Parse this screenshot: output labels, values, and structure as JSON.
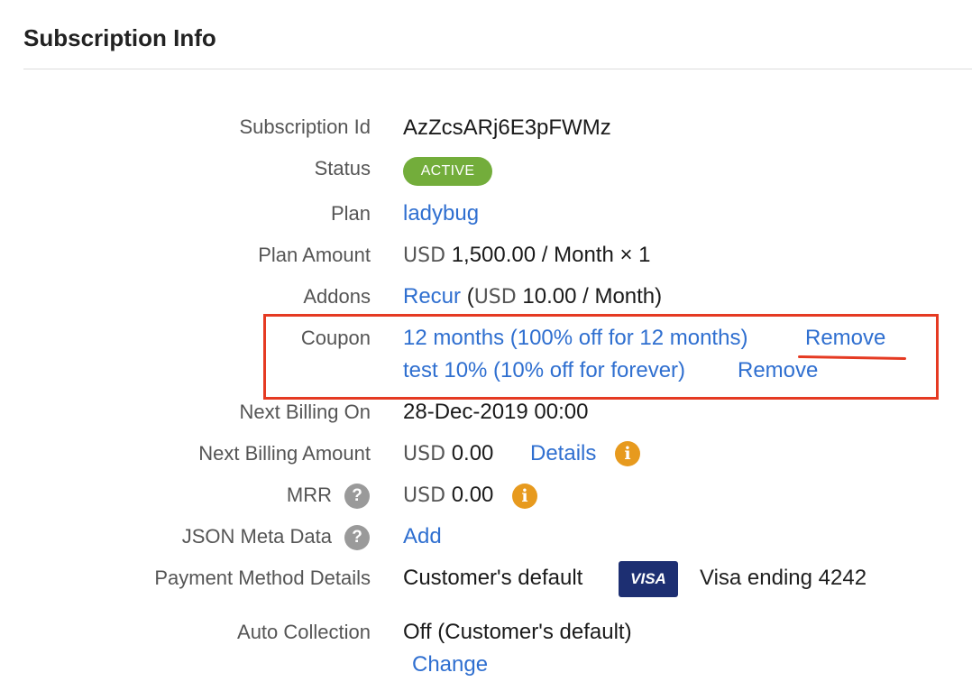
{
  "title": "Subscription Info",
  "fields": {
    "subscription_id": {
      "label": "Subscription Id",
      "value": "AzZcsARj6E3pFWMz"
    },
    "status": {
      "label": "Status",
      "value": "ACTIVE"
    },
    "plan": {
      "label": "Plan",
      "value": "ladybug"
    },
    "plan_amount": {
      "label": "Plan Amount",
      "currency": "USD",
      "value": "1,500.00 / Month × 1"
    },
    "addons": {
      "label": "Addons",
      "name": "Recur",
      "open": "(",
      "currency": "USD",
      "value": "10.00 / Month)"
    },
    "coupon": {
      "label": "Coupon",
      "items": [
        {
          "text": "12 months (100% off for 12 months)",
          "action": "Remove"
        },
        {
          "text": "test 10% (10% off for forever)",
          "action": "Remove"
        }
      ]
    },
    "next_billing_on": {
      "label": "Next Billing On",
      "value": "28-Dec-2019 00:00"
    },
    "next_billing_amount": {
      "label": "Next Billing Amount",
      "currency": "USD",
      "value": "0.00",
      "link": "Details"
    },
    "mrr": {
      "label": "MRR",
      "currency": "USD",
      "value": "0.00"
    },
    "json_meta": {
      "label": "JSON Meta Data",
      "link": "Add"
    },
    "payment_method": {
      "label": "Payment Method Details",
      "value": "Customer's default",
      "card_brand": "VISA",
      "card_text": "Visa ending 4242"
    },
    "auto_collection": {
      "label": "Auto Collection",
      "value": "Off (Customer's default)",
      "link": "Change"
    }
  },
  "icons": {
    "info": "i",
    "help": "?"
  },
  "colors": {
    "link": "#2f6fd0",
    "active_badge": "#73ad3b",
    "info_icon": "#e79a1e",
    "highlight": "#e53a22",
    "visa_bg": "#1d2f72"
  }
}
